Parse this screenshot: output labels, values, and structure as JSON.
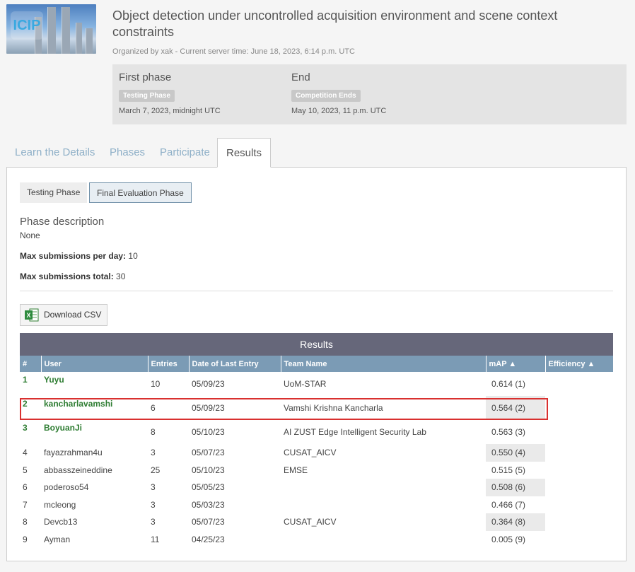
{
  "header": {
    "title": "Object detection under uncontrolled acquisition environment and scene context constraints",
    "organizer_line": "Organized by xak - Current server time: June 18, 2023, 6:14 p.m. UTC",
    "logo_text": "ICIP"
  },
  "phases": [
    {
      "name": "First phase",
      "badge": "Testing Phase",
      "date": "March 7, 2023, midnight UTC"
    },
    {
      "name": "End",
      "badge": "Competition Ends",
      "date": "May 10, 2023, 11 p.m. UTC"
    }
  ],
  "tabs": [
    "Learn the Details",
    "Phases",
    "Participate",
    "Results"
  ],
  "active_tab": "Results",
  "subtabs": [
    "Testing Phase",
    "Final Evaluation Phase"
  ],
  "active_subtab": "Final Evaluation Phase",
  "phase_description": {
    "label": "Phase description",
    "value": "None"
  },
  "max_per_day": {
    "label": "Max submissions per day:",
    "value": "10"
  },
  "max_total": {
    "label": "Max submissions total:",
    "value": "30"
  },
  "download_csv_label": "Download CSV",
  "results": {
    "heading": "Results",
    "columns": [
      "#",
      "User",
      "Entries",
      "Date of Last Entry",
      "Team Name",
      "mAP ▲",
      "Efficiency ▲"
    ],
    "rows": [
      {
        "rank": "1",
        "user": "Yuyu",
        "entries": "10",
        "date": "05/09/23",
        "team": "UoM-STAR",
        "map": "0.614 (1)",
        "top": true,
        "shade": false
      },
      {
        "rank": "2",
        "user": "kancharlavamshi",
        "entries": "6",
        "date": "05/09/23",
        "team": "Vamshi Krishna Kancharla",
        "map": "0.564 (2)",
        "top": true,
        "shade": true
      },
      {
        "rank": "3",
        "user": "BoyuanJi",
        "entries": "8",
        "date": "05/10/23",
        "team": "AI ZUST Edge Intelligent Security Lab",
        "map": "0.563 (3)",
        "top": true,
        "shade": false
      },
      {
        "rank": "4",
        "user": "fayazrahman4u",
        "entries": "3",
        "date": "05/07/23",
        "team": "CUSAT_AICV",
        "map": "0.550 (4)",
        "top": false,
        "shade": true
      },
      {
        "rank": "5",
        "user": "abbasszeineddine",
        "entries": "25",
        "date": "05/10/23",
        "team": "EMSE",
        "map": "0.515 (5)",
        "top": false,
        "shade": false
      },
      {
        "rank": "6",
        "user": "poderoso54",
        "entries": "3",
        "date": "05/05/23",
        "team": "",
        "map": "0.508 (6)",
        "top": false,
        "shade": true
      },
      {
        "rank": "7",
        "user": "mcleong",
        "entries": "3",
        "date": "05/03/23",
        "team": "",
        "map": "0.466 (7)",
        "top": false,
        "shade": false
      },
      {
        "rank": "8",
        "user": "Devcb13",
        "entries": "3",
        "date": "05/07/23",
        "team": "CUSAT_AICV",
        "map": "0.364 (8)",
        "top": false,
        "shade": true
      },
      {
        "rank": "9",
        "user": "Ayman",
        "entries": "11",
        "date": "04/25/23",
        "team": "",
        "map": "0.005 (9)",
        "top": false,
        "shade": false
      }
    ]
  }
}
